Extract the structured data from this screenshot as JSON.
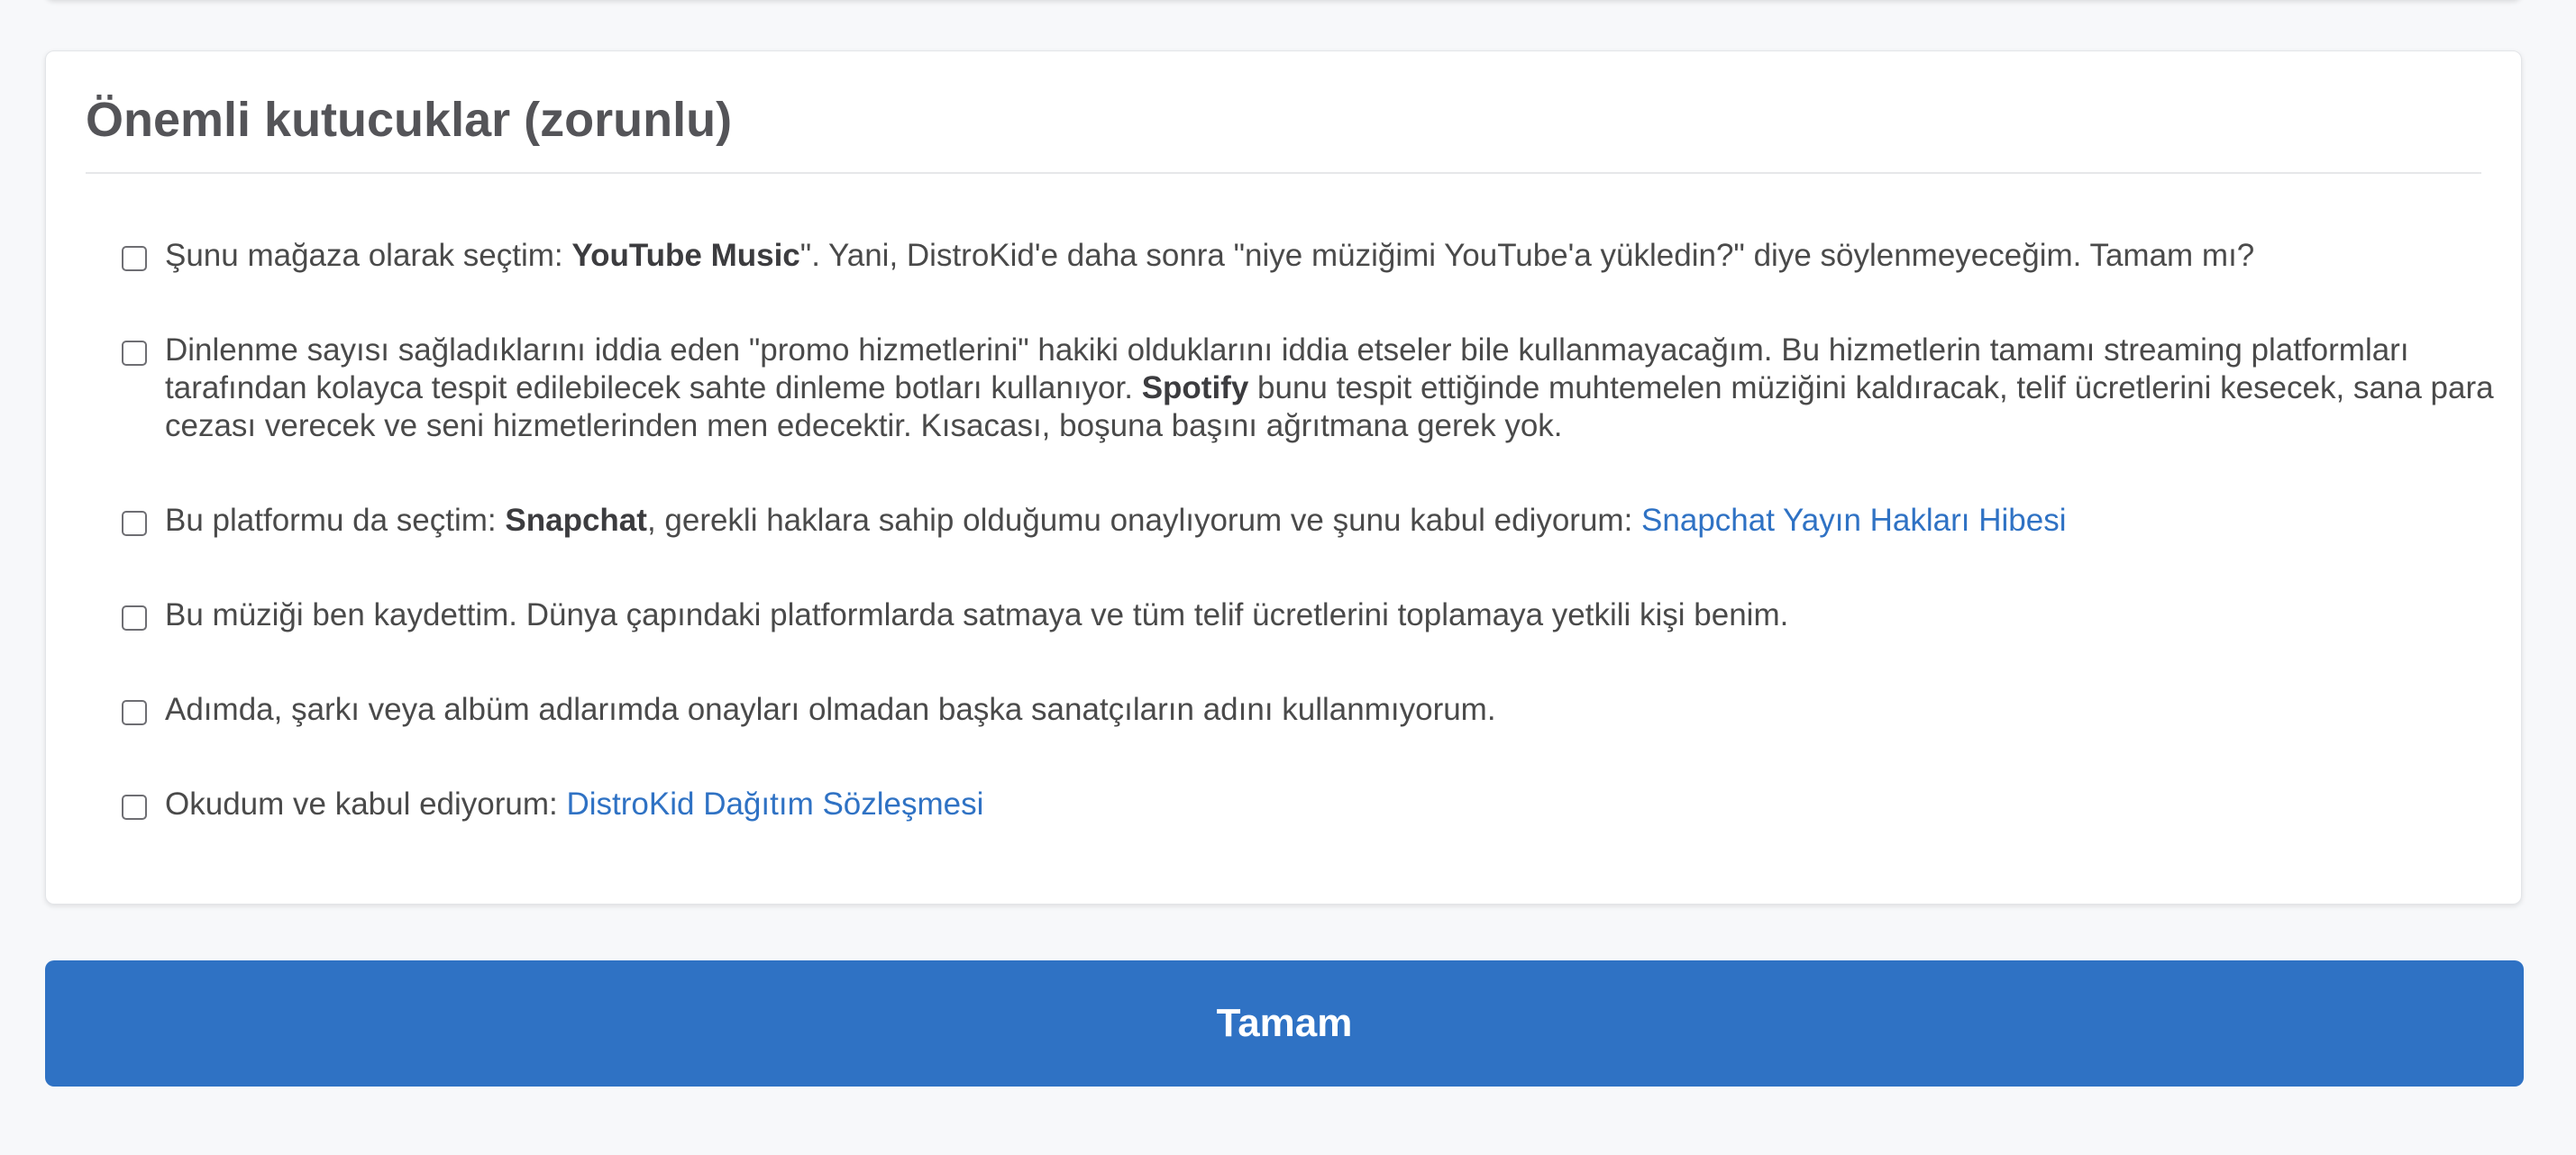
{
  "section": {
    "title": "Önemli kutucuklar (zorunlu)"
  },
  "checkboxes": [
    {
      "pre": "Şunu mağaza olarak seçtim: ",
      "bold": "YouTube Music",
      "post": "\". Yani, DistroKid'e daha sonra \"niye müziğimi YouTube'a yükledin?\" diye söylenmeyeceğim. Tamam mı?",
      "checked": false
    },
    {
      "pre": "Dinlenme sayısı sağladıklarını iddia eden \"promo hizmetlerini\" hakiki olduklarını iddia etseler bile kullanmayacağım. Bu hizmetlerin tamamı streaming platformları tarafından kolayca tespit edilebilecek sahte dinleme botları kullanıyor. ",
      "bold": "Spotify",
      "post": " bunu tespit ettiğinde muhtemelen müziğini kaldıracak, telif ücretlerini kesecek, sana para cezası verecek ve seni hizmetlerinden men edecektir. Kısacası, boşuna başını ağrıtmana gerek yok.",
      "checked": false
    },
    {
      "pre": "Bu platformu da seçtim: ",
      "bold": "Snapchat",
      "post": ", gerekli haklara sahip olduğumu onaylıyorum ve şunu kabul ediyorum: ",
      "link": "Snapchat Yayın Hakları Hibesi",
      "checked": false
    },
    {
      "text": "Bu müziği ben kaydettim. Dünya çapındaki platformlarda satmaya ve tüm telif ücretlerini toplamaya yetkili kişi benim.",
      "checked": false
    },
    {
      "text": "Adımda, şarkı veya albüm adlarımda onayları olmadan başka sanatçıların adını kullanmıyorum.",
      "checked": false
    },
    {
      "pre": "Okudum ve kabul ediyorum: ",
      "link": "DistroKid Dağıtım Sözleşmesi",
      "checked": false
    }
  ],
  "submit": {
    "label": "Tamam"
  },
  "colors": {
    "accent": "#2f72c4",
    "page_background": "#f7f8fa",
    "card_background": "#ffffff",
    "text": "#4a4a4a"
  }
}
